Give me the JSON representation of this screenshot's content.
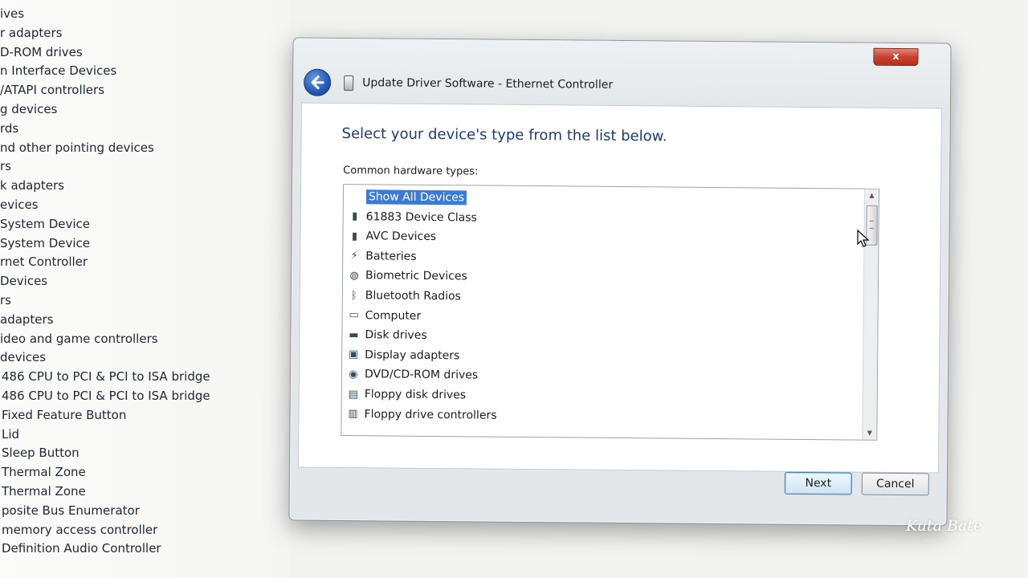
{
  "background_tree": [
    "ives",
    "r adapters",
    "D-ROM drives",
    "n Interface Devices",
    "/ATAPI controllers",
    "g devices",
    "rds",
    "nd other pointing devices",
    "rs",
    "k adapters",
    "evices",
    " System Device",
    " System Device",
    "rnet Controller",
    " Devices",
    "rs",
    "adapters",
    "ideo and game controllers",
    "devices",
    "486 CPU to PCI & PCI to ISA bridge",
    "486 CPU to PCI & PCI to ISA bridge",
    "Fixed Feature Button",
    "Lid",
    "Sleep Button",
    "Thermal Zone",
    "Thermal Zone",
    "posite Bus Enumerator",
    "memory access controller",
    "Definition Audio Controller"
  ],
  "dialog": {
    "close_label": "x",
    "title": "Update Driver Software - Ethernet Controller",
    "heading": "Select your device's type from the list below.",
    "list_label": "Common hardware types:",
    "items": [
      {
        "label": "Show All Devices",
        "icon": "none",
        "selected": true
      },
      {
        "label": "61883 Device Class",
        "icon": "plug-icon",
        "selected": false
      },
      {
        "label": "AVC Devices",
        "icon": "plug-icon",
        "selected": false
      },
      {
        "label": "Batteries",
        "icon": "battery-icon",
        "selected": false
      },
      {
        "label": "Biometric Devices",
        "icon": "fingerprint-icon",
        "selected": false
      },
      {
        "label": "Bluetooth Radios",
        "icon": "bluetooth-icon",
        "selected": false
      },
      {
        "label": "Computer",
        "icon": "computer-icon",
        "selected": false
      },
      {
        "label": "Disk drives",
        "icon": "disk-drive-icon",
        "selected": false
      },
      {
        "label": "Display adapters",
        "icon": "display-adapter-icon",
        "selected": false
      },
      {
        "label": "DVD/CD-ROM drives",
        "icon": "dvd-drive-icon",
        "selected": false
      },
      {
        "label": "Floppy disk drives",
        "icon": "floppy-drive-icon",
        "selected": false
      },
      {
        "label": "Floppy drive controllers",
        "icon": "floppy-controller-icon",
        "selected": false
      }
    ],
    "buttons": {
      "next": "Next",
      "cancel": "Cancel"
    }
  },
  "watermark": "Kuta Bate",
  "colors": {
    "selection": "#3a7ad8",
    "heading": "#1b3a7a",
    "close_button": "#c8412f"
  }
}
